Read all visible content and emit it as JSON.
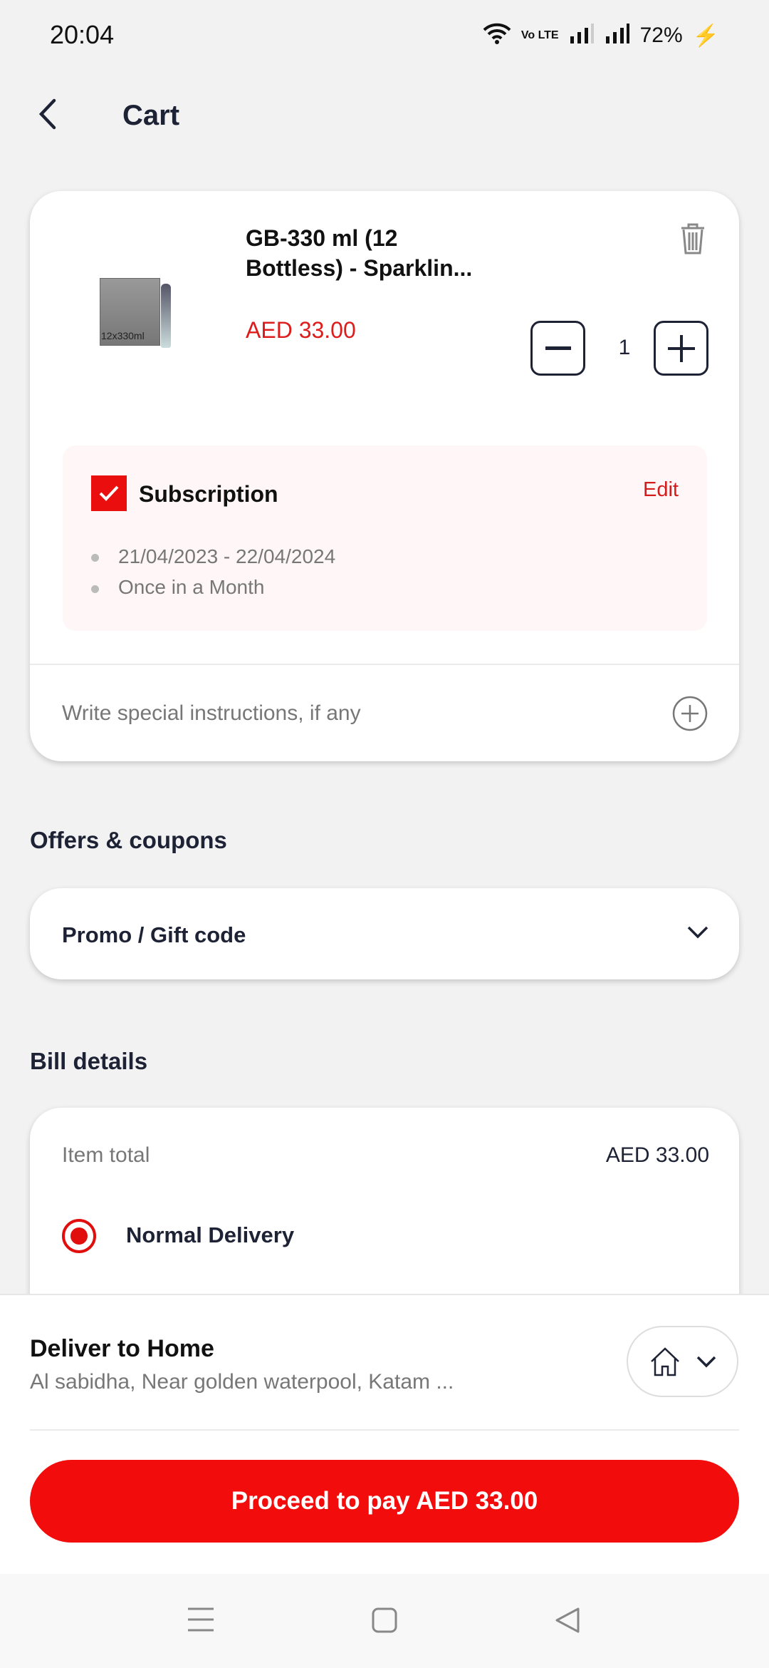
{
  "status_bar": {
    "time": "20:04",
    "network": "Vo LTE",
    "battery": "72%"
  },
  "header": {
    "title": "Cart"
  },
  "cart_item": {
    "name_line1": "GB-330 ml (12",
    "name_line2": "Bottless) - Sparklin...",
    "price": "AED 33.00",
    "quantity": "1",
    "image_label": "12x330ml"
  },
  "subscription": {
    "label": "Subscription",
    "checked": true,
    "edit": "Edit",
    "dates": "21/04/2023 - 22/04/2024",
    "frequency": "Once in a Month"
  },
  "instructions": {
    "placeholder": "Write special instructions, if any"
  },
  "offers": {
    "heading": "Offers & coupons",
    "promo_label": "Promo / Gift code"
  },
  "bill": {
    "heading": "Bill details",
    "item_total_label": "Item total",
    "item_total_value": "AED 33.00",
    "delivery_option": "Normal Delivery",
    "delivery_selected": true
  },
  "delivery": {
    "title": "Deliver to Home",
    "address": "Al sabidha, Near golden waterpool, Katam ..."
  },
  "pay_button": "Proceed to pay AED 33.00",
  "colors": {
    "accent": "#f20c0c",
    "text": "#1e2235"
  }
}
